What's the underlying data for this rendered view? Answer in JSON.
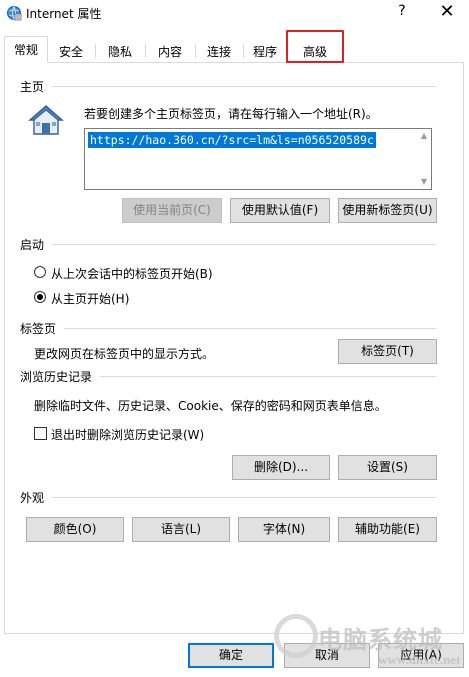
{
  "window": {
    "title": "Internet 属性",
    "help_label": "?",
    "close_label": "✕",
    "icon": "internet-options-icon"
  },
  "tabs": [
    {
      "label": "常规",
      "active": true
    },
    {
      "label": "安全",
      "active": false
    },
    {
      "label": "隐私",
      "active": false
    },
    {
      "label": "内容",
      "active": false
    },
    {
      "label": "连接",
      "active": false
    },
    {
      "label": "程序",
      "active": false
    },
    {
      "label": "高级",
      "active": false,
      "highlighted": true
    }
  ],
  "highlight_color": "#e02020",
  "home": {
    "section_title": "主页",
    "hint": "若要创建多个主页标签页，请在每行输入一个地址(R)。",
    "url": "https://hao.360.cn/?src=lm&ls=n056520589c",
    "buttons": {
      "use_current": "使用当前页(C)",
      "use_default": "使用默认值(F)",
      "use_new_tab": "使用新标签页(U)"
    },
    "use_current_enabled": false
  },
  "startup": {
    "section_title": "启动",
    "options": [
      {
        "label": "从上次会话中的标签页开始(B)",
        "checked": false
      },
      {
        "label": "从主页开始(H)",
        "checked": true
      }
    ]
  },
  "tabs_section": {
    "section_title": "标签页",
    "description": "更改网页在标签页中的显示方式。",
    "button": "标签页(T)"
  },
  "history": {
    "section_title": "浏览历史记录",
    "description": "删除临时文件、历史记录、Cookie、保存的密码和网页表单信息。",
    "checkbox_label": "退出时删除浏览历史记录(W)",
    "checkbox_checked": false,
    "delete_button": "删除(D)...",
    "settings_button": "设置(S)"
  },
  "appearance": {
    "section_title": "外观",
    "buttons": [
      "颜色(O)",
      "语言(L)",
      "字体(N)",
      "辅助功能(E)"
    ]
  },
  "footer": {
    "ok": "确定",
    "cancel": "取消",
    "apply": "应用(A)"
  },
  "watermark": {
    "text": "电脑系统城",
    "url": "www.dnxtc.net"
  },
  "colors": {
    "selection": "#0078d7",
    "button_face": "#e1e1e1",
    "button_disabled": "#cccccc"
  }
}
